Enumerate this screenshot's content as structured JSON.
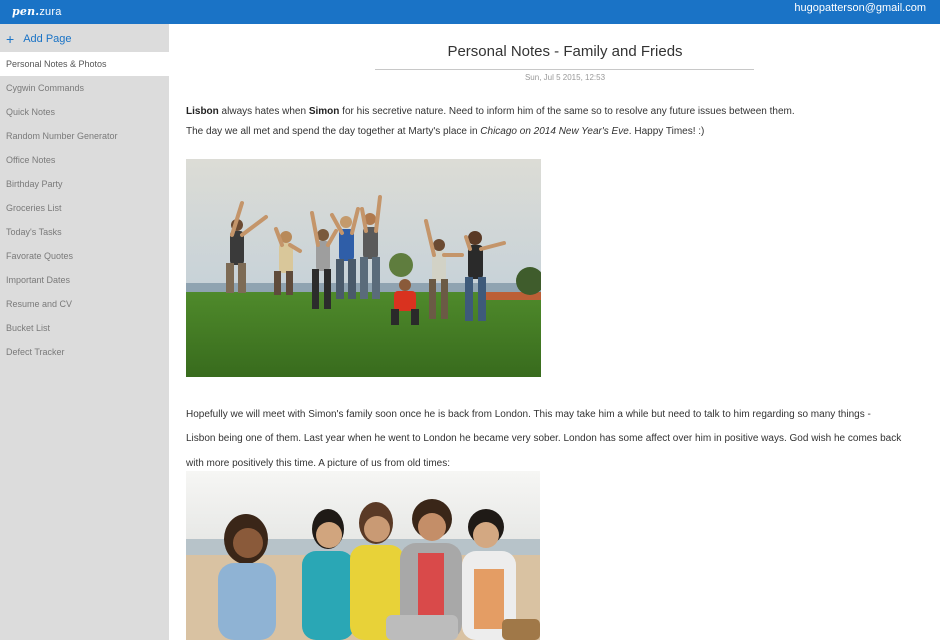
{
  "header": {
    "logo_script": "pen.",
    "logo_text": "zura",
    "user_email": "hugopatterson@gmail.com"
  },
  "sidebar": {
    "add_page_label": "Add Page",
    "items": [
      {
        "label": "Personal Notes & Photos"
      },
      {
        "label": "Cygwin Commands"
      },
      {
        "label": "Quick Notes"
      },
      {
        "label": "Random Number Generator"
      },
      {
        "label": "Office Notes"
      },
      {
        "label": "Birthday Party"
      },
      {
        "label": "Groceries List"
      },
      {
        "label": "Today's Tasks"
      },
      {
        "label": "Favorate Quotes"
      },
      {
        "label": "Important Dates"
      },
      {
        "label": "Resume and CV"
      },
      {
        "label": "Bucket List"
      },
      {
        "label": "Defect Tracker"
      }
    ]
  },
  "note": {
    "title": "Personal Notes - Family and Frieds",
    "date": "Sun, Jul 5 2015, 12:53",
    "p1_name1": "Lisbon",
    "p1_text1": " always hates when ",
    "p1_name2": "Simon",
    "p1_text2": " for his secretive nature. Need to inform him of the same so to resolve any future issues between them.",
    "p2_text1": "The day we all met and spend the day together at Marty's place in ",
    "p2_italic": "Chicago on 2014 New Year's Eve",
    "p2_text2": ". Happy Times! :)",
    "p3_line1": "Hopefully we will meet with Simon's family soon once he is back from London. This may take him a while but need to talk to him regarding so many things -",
    "p3_line2": "Lisbon being one of them. Last year when he went to London he became very sober. London has some affect over him in positive ways. God wish he comes back",
    "p3_line3": "with more positively this time. A picture of us from old times:"
  },
  "colors": {
    "topbar": "#1a73c6",
    "sidebar_bg": "#dcdcdc",
    "accent": "#1a73c6"
  }
}
